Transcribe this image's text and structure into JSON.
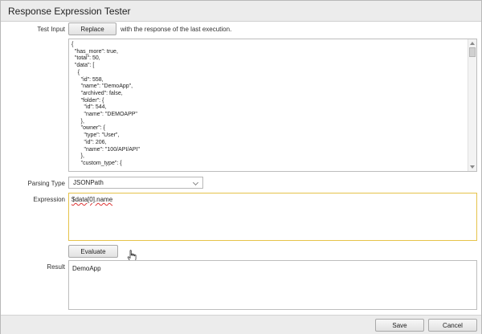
{
  "dialog": {
    "title": "Response Expression Tester"
  },
  "test_input": {
    "label": "Test Input",
    "replace_button": "Replace",
    "replace_hint": "with the response of the last execution.",
    "lines": [
      "{",
      "  \"has_more\": true,",
      "  \"total\": 50,",
      "  \"data\": [",
      "    {",
      "      \"id\": 558,",
      "      \"name\": \"DemoApp\",",
      "      \"archived\": false,",
      "      \"folder\": {",
      "        \"id\": 544,",
      "        \"name\": \"DEMOAPP\"",
      "      },",
      "      \"owner\": {",
      "        \"type\": \"User\",",
      "        \"id\": 206,",
      "        \"name\": \"100/API/API\"",
      "      },",
      "      \"custom_type\": {"
    ]
  },
  "parsing": {
    "label": "Parsing Type",
    "value": "JSONPath"
  },
  "expression": {
    "label": "Expression",
    "value": "$data[0].name"
  },
  "evaluate": {
    "label": "Evaluate"
  },
  "result": {
    "label": "Result",
    "value": "DemoApp"
  },
  "footer": {
    "save_label": "Save",
    "cancel_label": "Cancel"
  },
  "icons": {
    "cursor": "hand-pointer-icon",
    "dropdown": "chevron-down-icon"
  },
  "colors": {
    "expression_focus_border": "#e6c34a",
    "spellcheck_underline": "#d33"
  }
}
